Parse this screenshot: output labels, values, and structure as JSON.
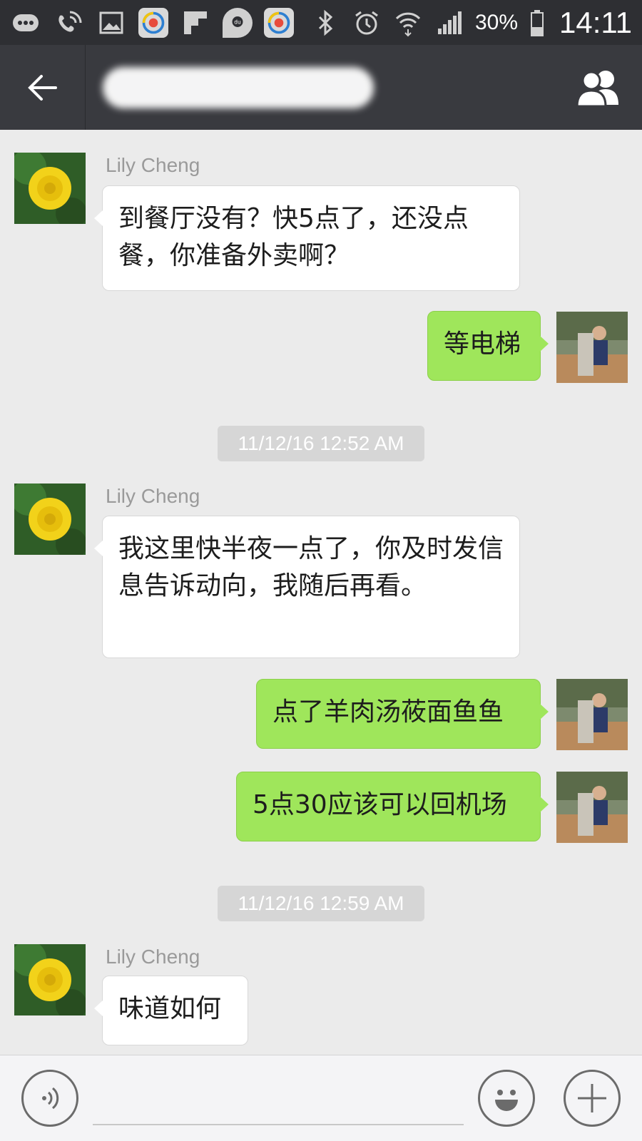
{
  "status_bar": {
    "icons": [
      "chat-bubble-icon",
      "wifi-call-icon",
      "image-icon",
      "app-icon",
      "flipboard-icon",
      "baidu-map-icon",
      "app-icon",
      "bluetooth-icon",
      "alarm-icon",
      "wifi-icon",
      "signal-icon",
      "battery-icon"
    ],
    "battery": "30%",
    "time": "14:11"
  },
  "header": {
    "back_icon": "arrow-left-icon",
    "title_redacted": true,
    "group_icon": "group-members-icon"
  },
  "messages": [
    {
      "type": "incoming",
      "sender": "Lily Cheng",
      "text": "到餐厅没有？快5点了，还没点餐，你准备外卖啊？"
    },
    {
      "type": "outgoing",
      "text": "等电梯"
    },
    {
      "type": "timestamp",
      "text": "11/12/16 12:52 AM"
    },
    {
      "type": "incoming",
      "sender": "Lily Cheng",
      "text": "我这里快半夜一点了，你及时发信息告诉动向，我随后再看。"
    },
    {
      "type": "outgoing",
      "text": "点了羊肉汤莜面鱼鱼"
    },
    {
      "type": "outgoing",
      "text": "5点30应该可以回机场"
    },
    {
      "type": "timestamp",
      "text": "11/12/16 12:59 AM"
    },
    {
      "type": "incoming",
      "sender": "Lily Cheng",
      "text": "味道如何"
    }
  ],
  "input_bar": {
    "voice_icon": "voice-icon",
    "emoji_icon": "emoji-icon",
    "plus_icon": "plus-icon",
    "placeholder": ""
  },
  "colors": {
    "status_bar": "#2e2f33",
    "header": "#393a3f",
    "chat_background": "#ebebeb",
    "outgoing_bubble": "#9fe65b",
    "incoming_bubble": "#ffffff"
  }
}
